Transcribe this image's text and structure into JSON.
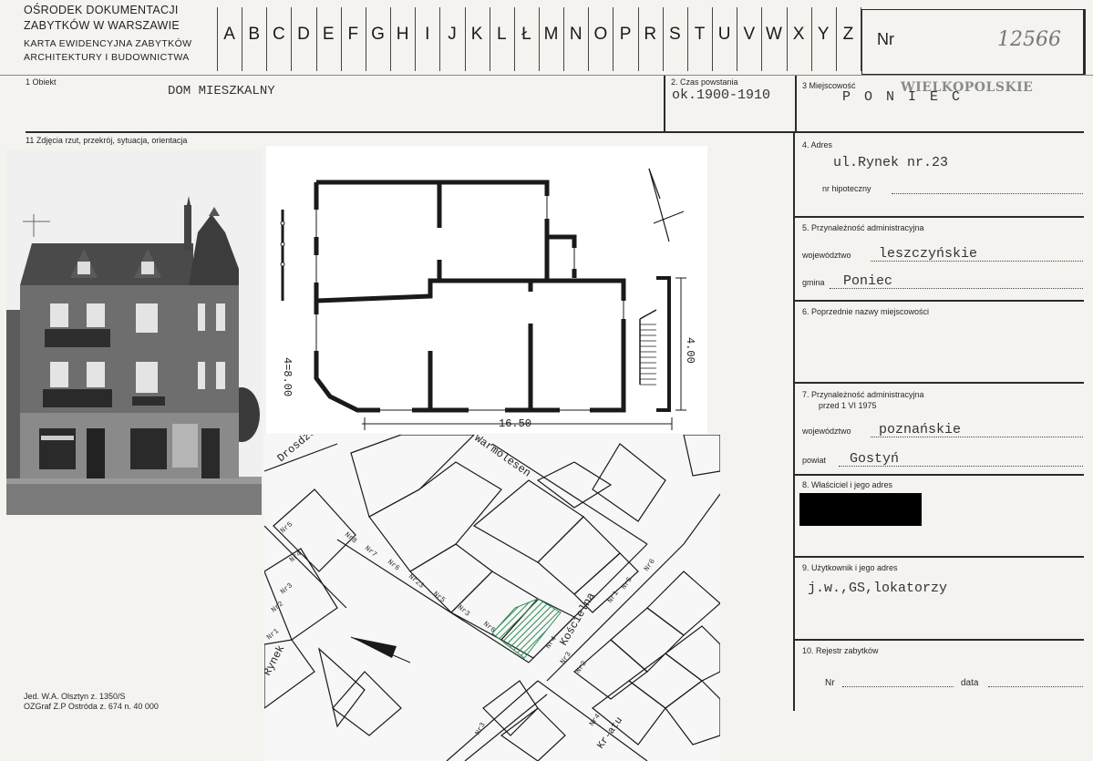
{
  "header": {
    "org_line1": "OŚRODEK DOKUMENTACJI",
    "org_line2": "ZABYTKÓW W WARSZAWIE",
    "org_line3": "KARTA EWIDENCYJNA ZABYTKÓW",
    "org_line4": "ARCHITEKTURY I BUDOWNICTWA",
    "alphabet": [
      "A",
      "B",
      "C",
      "D",
      "E",
      "F",
      "G",
      "H",
      "I",
      "J",
      "K",
      "L",
      "Ł",
      "M",
      "N",
      "O",
      "P",
      "R",
      "S",
      "T",
      "U",
      "V",
      "W",
      "X",
      "Y",
      "Z"
    ],
    "nr_label": "Nr",
    "nr_value": "12566"
  },
  "fields": {
    "f1_label": "1  Obiekt",
    "f1_value": "DOM MIESZKALNY",
    "f2_label": "2. Czas powstania",
    "f2_value": "ok.1900-1910",
    "f3_label": "3  Miejscowość",
    "f3_value": "P O N I E C",
    "f3_stamp": "WIELKOPOLSKIE",
    "f11_label": "11  Zdjęcia  rzut,  przekrój,  sytuacja,  orientacja",
    "f4_label": "4. Adres",
    "f4_value": "ul.Rynek nr.23",
    "f4_sub": "nr  hipoteczny",
    "f5_label": "5. Przynależność  administracyjna",
    "f5_woj_label": "województwo",
    "f5_woj_value": "leszczyńskie",
    "f5_gmina_label": "gmina",
    "f5_gmina_value": "Poniec",
    "f6_label": "6. Poprzednie  nazwy  miejscowości",
    "f7_label": "7. Przynależność  administracyjna",
    "f7_label2": "przed  1  VI  1975",
    "f7_woj_label": "województwo",
    "f7_woj_value": "poznańskie",
    "f7_powiat_label": "powiat",
    "f7_powiat_value": "Gostyń",
    "f8_label": "8. Właściciel  i  jego  adres",
    "f9_label": "9. Użytkownik  i  jego  adres",
    "f9_value": "j.w.,GS,lokatorzy",
    "f10_label": "10. Rejestr  zabytków",
    "f10_nr": "Nr",
    "f10_data": "data"
  },
  "footer": {
    "line1": "Jed. W.A. Olsztyn  z. 1350/S",
    "line2": "OZGraf  Z.P  Ostróda  z.  674  n.  40 000"
  },
  "plan": {
    "dim_width": "16.50",
    "dim_depth_left": "4=8.00",
    "dim_depth_right": "4.00"
  },
  "map": {
    "street_warm": "Warmolesen",
    "street_drosdz": "Drosdzew",
    "street_rynek": "Rynek",
    "street_kosc": "Kościelna",
    "street_kr": "Kr-atu",
    "nr_labels": [
      "Nr5",
      "Nr4",
      "Nr3",
      "Nr2",
      "Nr1",
      "Nr8",
      "Nr7",
      "Nr6",
      "Nr23",
      "Nr5",
      "Nr3",
      "Nr6",
      "Nr4",
      "Nr3",
      "Nr2",
      "Nr1",
      "Nr5",
      "Nr6",
      "Nr3",
      "Nr4"
    ]
  },
  "colors": {
    "paper": "#f4f3ef",
    "ink": "#1f1f1f",
    "hatch": "#2e8b57"
  }
}
